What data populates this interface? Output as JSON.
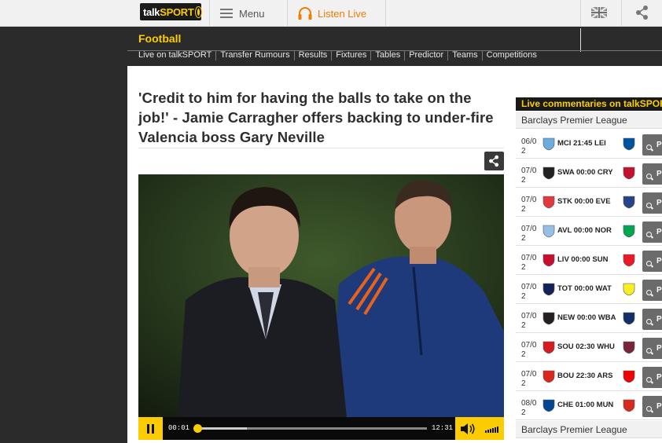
{
  "header": {
    "logo_text_a": "talk",
    "logo_text_b": "SPORT",
    "menu_label": "Menu",
    "listen_label": "Listen Live",
    "colors": {
      "accent": "#fbcd00",
      "listen": "#f07c00"
    }
  },
  "section": {
    "title": "Football",
    "subnav": [
      "Live on talkSPORT",
      "Transfer Rumours",
      "Results",
      "Fixtures",
      "Tables",
      "Predictor",
      "Teams",
      "Competitions"
    ]
  },
  "article": {
    "headline": "'Credit to him for having the balls to take on the job!' - Jamie Carragher offers backing to under-fire Valencia boss Gary Neville"
  },
  "player": {
    "time_current": "00:01",
    "time_duration": "12:31",
    "progress": 0.0
  },
  "sidebar": {
    "title": "Live commentaries on talkSPORT",
    "league_top": "Barclays Premier League",
    "league_bottom": "Barclays Premier League",
    "button_label": "P",
    "fixtures": [
      {
        "date": "06/0 2",
        "home": "MCI",
        "time": "21:45",
        "away": "LEI",
        "home_color": "#6cabdd",
        "away_color": "#0053a0"
      },
      {
        "date": "07/0 2",
        "home": "SWA",
        "time": "00:00",
        "away": "CRY",
        "home_color": "#222222",
        "away_color": "#c4122e"
      },
      {
        "date": "07/0 2",
        "home": "STK",
        "time": "00:00",
        "away": "EVE",
        "home_color": "#e03a3e",
        "away_color": "#274488"
      },
      {
        "date": "07/0 2",
        "home": "AVL",
        "time": "00:00",
        "away": "NOR",
        "home_color": "#95bfe5",
        "away_color": "#00a650"
      },
      {
        "date": "07/0 2",
        "home": "LIV",
        "time": "00:00",
        "away": "SUN",
        "home_color": "#c8102e",
        "away_color": "#eb172b"
      },
      {
        "date": "07/0 2",
        "home": "TOT",
        "time": "00:00",
        "away": "WAT",
        "home_color": "#132257",
        "away_color": "#fbee23"
      },
      {
        "date": "07/0 2",
        "home": "NEW",
        "time": "00:00",
        "away": "WBA",
        "home_color": "#241f20",
        "away_color": "#122f67"
      },
      {
        "date": "07/0 2",
        "home": "SOU",
        "time": "02:30",
        "away": "WHU",
        "home_color": "#d71920",
        "away_color": "#7a263a"
      },
      {
        "date": "07/0 2",
        "home": "BOU",
        "time": "22:30",
        "away": "ARS",
        "home_color": "#da291c",
        "away_color": "#ef0107"
      },
      {
        "date": "08/0 2",
        "home": "CHE",
        "time": "01:00",
        "away": "MUN",
        "home_color": "#034694",
        "away_color": "#da291c"
      }
    ]
  }
}
